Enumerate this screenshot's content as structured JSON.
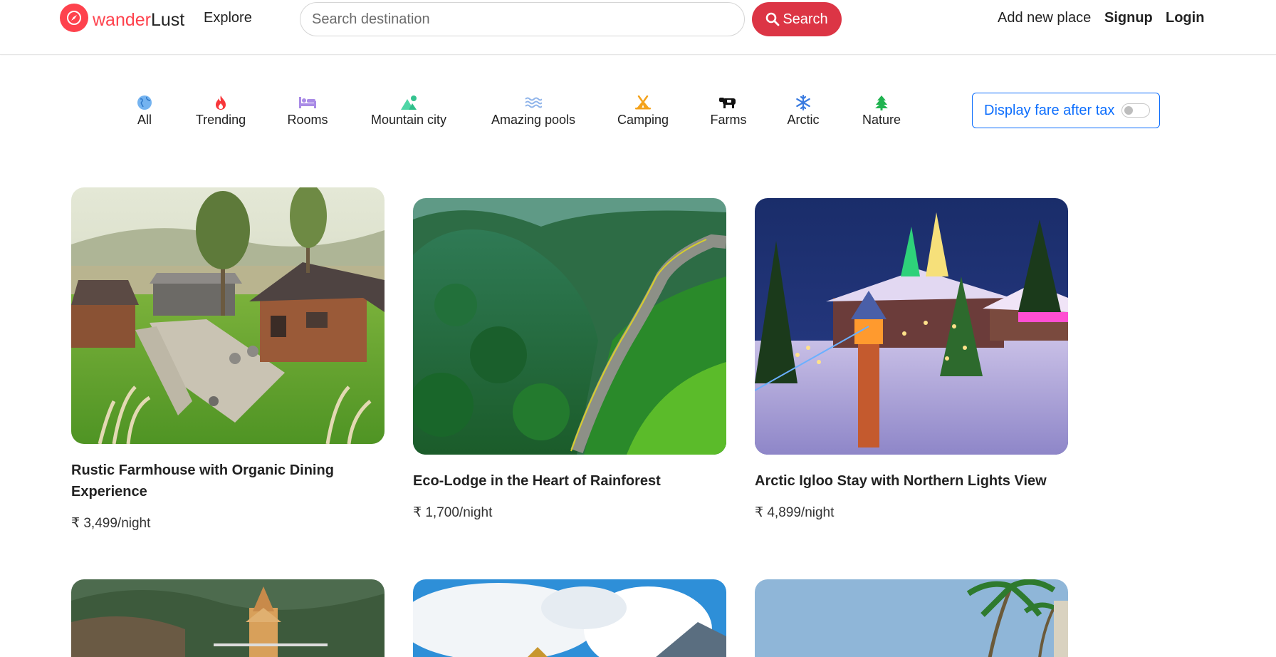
{
  "brand": {
    "name_part1": "wander",
    "name_part2": "Lust",
    "logo_icon": "compass-icon",
    "color": "#fe424d"
  },
  "nav": {
    "explore": "Explore",
    "search_placeholder": "Search destination",
    "search_button": "Search",
    "add_place": "Add new place",
    "signup": "Signup",
    "login": "Login"
  },
  "filters": [
    {
      "label": "All",
      "icon": "globe-icon"
    },
    {
      "label": "Trending",
      "icon": "fire-icon"
    },
    {
      "label": "Rooms",
      "icon": "bed-icon"
    },
    {
      "label": "Mountain city",
      "icon": "mountain-sun-icon"
    },
    {
      "label": "Amazing pools",
      "icon": "water-icon"
    },
    {
      "label": "Camping",
      "icon": "campground-icon"
    },
    {
      "label": "Farms",
      "icon": "cow-icon"
    },
    {
      "label": "Arctic",
      "icon": "snowflake-icon"
    },
    {
      "label": "Nature",
      "icon": "tree-icon"
    }
  ],
  "tax_toggle": {
    "label": "Display fare after tax",
    "enabled": false
  },
  "listings": [
    {
      "title": "Rustic Farmhouse with Organic Dining Experience",
      "price": "₹ 3,499/night"
    },
    {
      "title": "Eco-Lodge in the Heart of Rainforest",
      "price": "₹ 1,700/night"
    },
    {
      "title": "Arctic Igloo Stay with Northern Lights View",
      "price": "₹ 4,899/night"
    }
  ],
  "colors": {
    "accent": "#fe424d",
    "search_button": "#dc3545",
    "toggle_border": "#0d6efd"
  }
}
